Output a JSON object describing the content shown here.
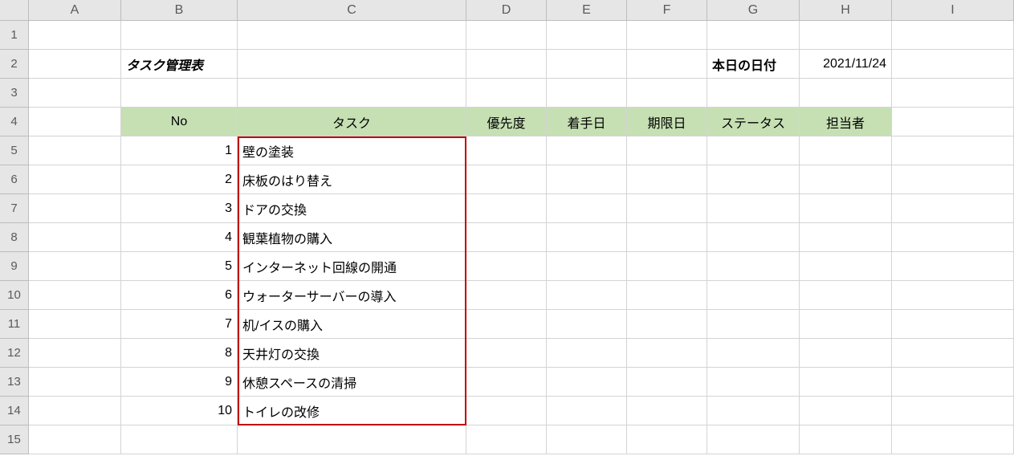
{
  "columns": [
    "A",
    "B",
    "C",
    "D",
    "E",
    "F",
    "G",
    "H",
    "I"
  ],
  "rowCount": 15,
  "title": "タスク管理表",
  "today_label": "本日の日付",
  "today_value": "2021/11/24",
  "table_headers": [
    "No",
    "タスク",
    "優先度",
    "着手日",
    "期限日",
    "ステータス",
    "担当者"
  ],
  "tasks": [
    {
      "no": "1",
      "name": "壁の塗装"
    },
    {
      "no": "2",
      "name": "床板のはり替え"
    },
    {
      "no": "3",
      "name": "ドアの交換"
    },
    {
      "no": "4",
      "name": "観葉植物の購入"
    },
    {
      "no": "5",
      "name": "インターネット回線の開通"
    },
    {
      "no": "6",
      "name": "ウォーターサーバーの導入"
    },
    {
      "no": "7",
      "name": "机/イスの購入"
    },
    {
      "no": "8",
      "name": "天井灯の交換"
    },
    {
      "no": "9",
      "name": "休憩スペースの清掃"
    },
    {
      "no": "10",
      "name": "トイレの改修"
    }
  ]
}
